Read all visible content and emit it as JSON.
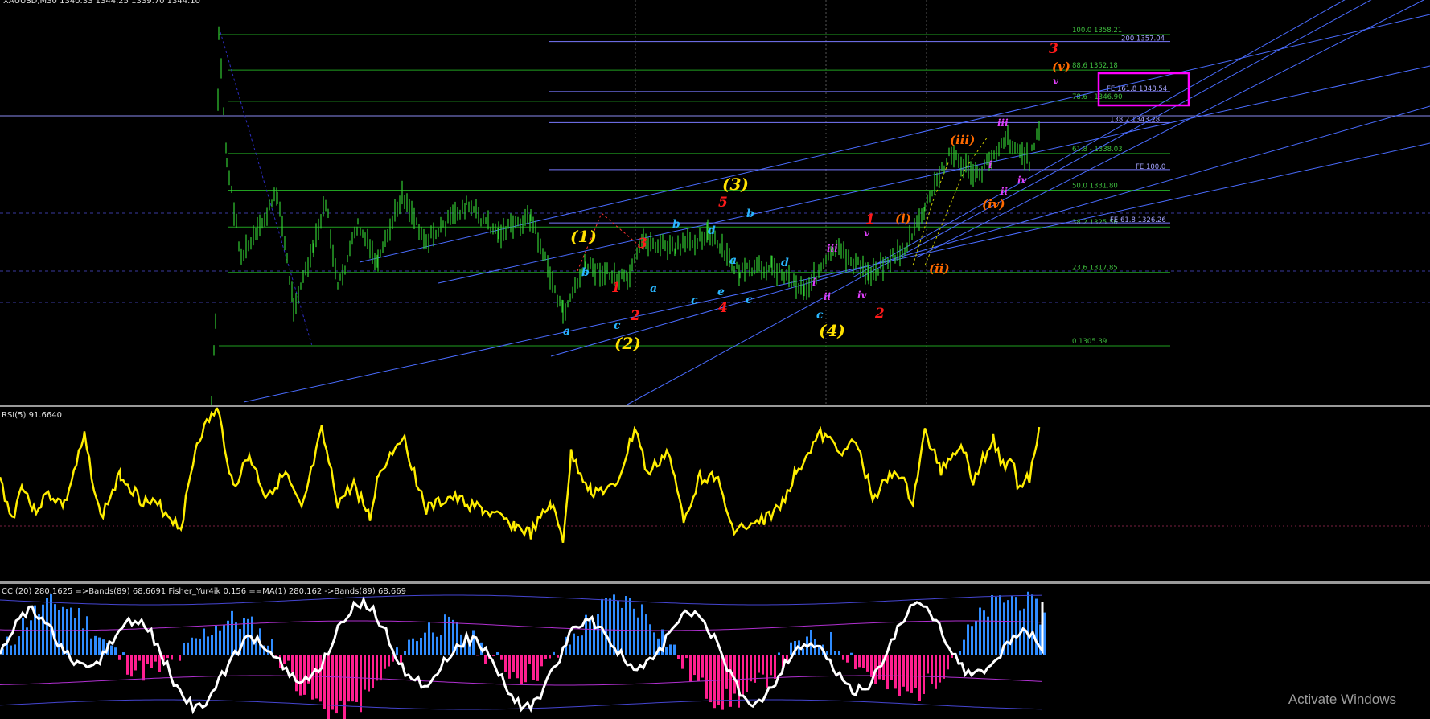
{
  "chart_data": [
    {
      "type": "line",
      "panel": "price",
      "title": "XAUUSD,M30  1340.33 1344.25 1339.70 1344.10",
      "fib_retracement": [
        {
          "label": "100.0 1358.21",
          "value": 1358.21
        },
        {
          "label": "88.6 1352.18",
          "value": 1352.18
        },
        {
          "label": "78.6 - 1346.90",
          "value": 1346.9
        },
        {
          "label": "61.8 - 1338.03",
          "value": 1338.03
        },
        {
          "label": "50.0 1331.80",
          "value": 1331.8
        },
        {
          "label": "38.2 1325.56",
          "value": 1325.56
        },
        {
          "label": "23.6 1317.85",
          "value": 1317.85
        },
        {
          "label": "0 1305.39",
          "value": 1305.39
        }
      ],
      "fib_extension": [
        {
          "label": "200 1357.04",
          "value": 1357.04
        },
        {
          "label": "FE 161.8 1348.54",
          "value": 1348.54,
          "highlighted": true
        },
        {
          "label": "138.2 1343.28",
          "value": 1343.28
        },
        {
          "label": "FE 100.0",
          "value": 1335.3
        },
        {
          "label": "FE 61.8 1326.26",
          "value": 1326.26
        }
      ],
      "wave_labels": [
        {
          "text": "(1)",
          "color": "#ffe100"
        },
        {
          "text": "(2)",
          "color": "#ffe100"
        },
        {
          "text": "(3)",
          "color": "#ffe100"
        },
        {
          "text": "(4)",
          "color": "#ffe100"
        },
        {
          "text": "1",
          "color": "#ff1a1a"
        },
        {
          "text": "2",
          "color": "#ff1a1a"
        },
        {
          "text": "3",
          "color": "#ff1a1a"
        },
        {
          "text": "4",
          "color": "#ff1a1a"
        },
        {
          "text": "5",
          "color": "#ff1a1a"
        },
        {
          "text": "1",
          "color": "#ff1a1a"
        },
        {
          "text": "2",
          "color": "#ff1a1a"
        },
        {
          "text": "3",
          "color": "#ff1a1a"
        },
        {
          "text": "a",
          "color": "#29b6ff"
        },
        {
          "text": "b",
          "color": "#29b6ff"
        },
        {
          "text": "c",
          "color": "#29b6ff"
        },
        {
          "text": "a",
          "color": "#29b6ff"
        },
        {
          "text": "b",
          "color": "#29b6ff"
        },
        {
          "text": "c",
          "color": "#29b6ff"
        },
        {
          "text": "d",
          "color": "#29b6ff"
        },
        {
          "text": "e",
          "color": "#29b6ff"
        },
        {
          "text": "a",
          "color": "#29b6ff"
        },
        {
          "text": "b",
          "color": "#29b6ff"
        },
        {
          "text": "c",
          "color": "#29b6ff"
        },
        {
          "text": "d",
          "color": "#29b6ff"
        },
        {
          "text": "c",
          "color": "#29b6ff"
        },
        {
          "text": "(i)",
          "color": "#ff6a00"
        },
        {
          "text": "(ii)",
          "color": "#ff6a00"
        },
        {
          "text": "(iii)",
          "color": "#ff6a00"
        },
        {
          "text": "(iv)",
          "color": "#ff6a00"
        },
        {
          "text": "(v)",
          "color": "#ff6a00"
        },
        {
          "text": "i",
          "color": "#e040fb"
        },
        {
          "text": "ii",
          "color": "#e040fb"
        },
        {
          "text": "iii",
          "color": "#e040fb"
        },
        {
          "text": "iv",
          "color": "#e040fb"
        },
        {
          "text": "v",
          "color": "#e040fb"
        },
        {
          "text": "i",
          "color": "#e040fb"
        },
        {
          "text": "ii",
          "color": "#e040fb"
        },
        {
          "text": "iii",
          "color": "#e040fb"
        },
        {
          "text": "iv",
          "color": "#e040fb"
        },
        {
          "text": "v",
          "color": "#e040fb"
        }
      ],
      "colors": {
        "candles": "#33cc33",
        "fib_retracement": "#21a121",
        "fib_extension": "#7a7aff",
        "channels": "#4a6cff",
        "highlight_box": "#ff00ff"
      }
    },
    {
      "type": "line",
      "panel": "rsi",
      "title": "RSI(5) 91.6640",
      "value": 91.664,
      "color": "#ffee00"
    },
    {
      "type": "bar",
      "panel": "cci",
      "title": "CCI(20) 280.1625  =>Bands(89) 68.6691  Fisher_Yur4ik 0.156  ==MA(1) 280.162  ->Bands(89) 68.669",
      "colors": {
        "positive": "#2f8cff",
        "negative": "#ff1f8f",
        "fisher": "#ffffff",
        "bands": "#4545d0"
      }
    }
  ],
  "watermark": "Activate Windows"
}
